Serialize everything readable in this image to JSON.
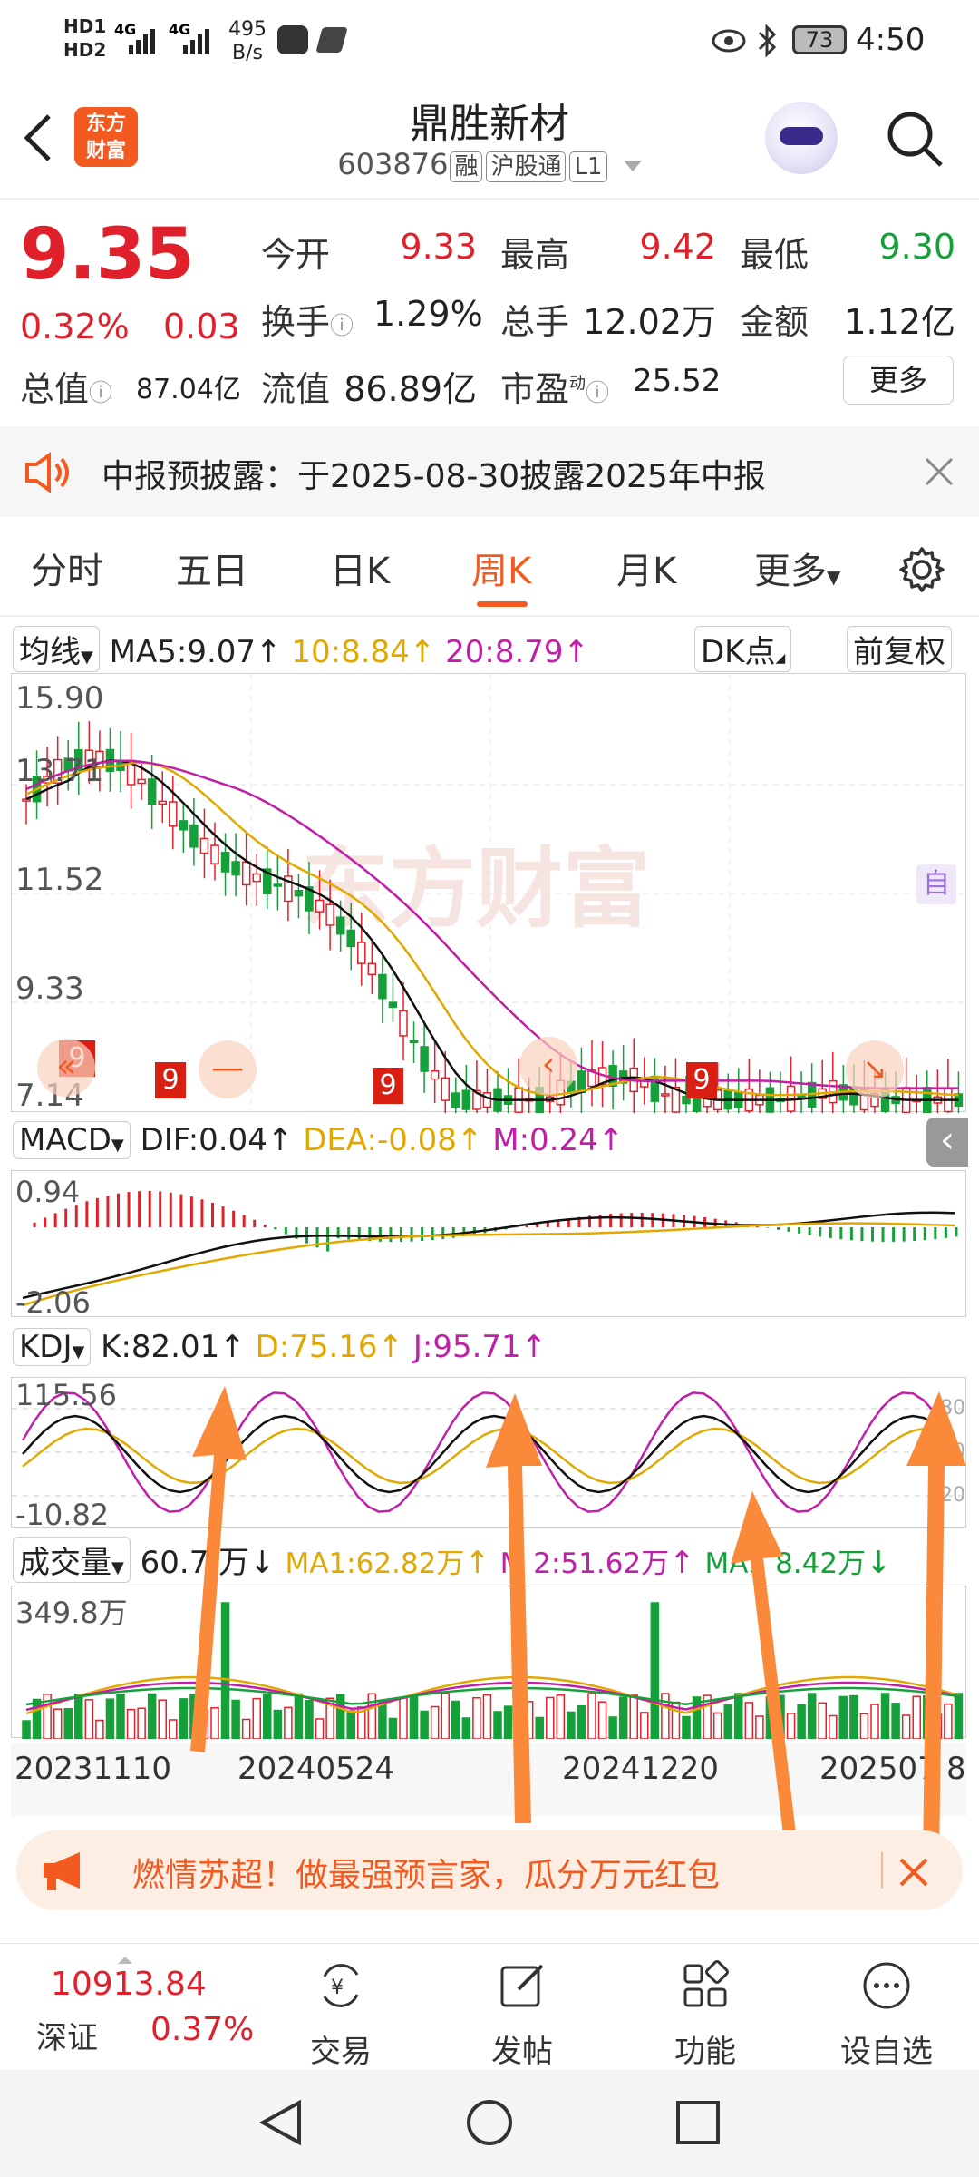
{
  "status_bar": {
    "left_icons": [
      "HD1",
      "HD2",
      "4G",
      "4G"
    ],
    "net_speed": "495",
    "net_unit": "B/s",
    "battery": "73",
    "time": "4:50"
  },
  "header": {
    "logo_text": "东方财富",
    "name": "鼎胜新材",
    "code": "603876",
    "tags": [
      "融",
      "沪股通",
      "L1"
    ]
  },
  "quote": {
    "price": "9.35",
    "change_pct": "0.32%",
    "change": "0.03",
    "open_label": "今开",
    "open": "9.33",
    "high_label": "最高",
    "high": "9.42",
    "low_label": "最低",
    "low": "9.30",
    "turnover_label": "换手",
    "turnover": "1.29%",
    "volume_label": "总手",
    "volume": "12.02万",
    "amount_label": "金额",
    "amount": "1.12亿",
    "mktcap_label": "总值",
    "mktcap": "87.04亿",
    "float_label": "流值",
    "float": "86.89亿",
    "pe_label": "市盈",
    "pe_sup": "动",
    "pe": "25.52",
    "more": "更多"
  },
  "notice": {
    "text": "中报预披露：于2025-08-30披露2025年中报"
  },
  "tabs": [
    {
      "label": "分时"
    },
    {
      "label": "五日"
    },
    {
      "label": "日K"
    },
    {
      "label": "周K"
    },
    {
      "label": "月K"
    },
    {
      "label": "更多"
    }
  ],
  "ma_bar": {
    "selector": "均线",
    "ma5": "MA5:9.07",
    "ma10": "10:8.84",
    "ma20": "20:8.79",
    "dk": "DK点",
    "adjust": "前复权"
  },
  "kline": {
    "y_labels": [
      "15.90",
      "13.71",
      "11.52",
      "9.33",
      "7.14"
    ],
    "watermark": "东方财富",
    "side_tag": "自",
    "nine_marks": [
      "9",
      "9",
      "9",
      "9"
    ]
  },
  "macd": {
    "selector": "MACD",
    "dif": "DIF:0.04",
    "dea": "DEA:-0.08",
    "m": "M:0.24",
    "y_top": "0.94",
    "y_bottom": "-2.06"
  },
  "kdj": {
    "selector": "KDJ",
    "k": "K:82.01",
    "d": "D:75.16",
    "j": "J:95.71",
    "y_top": "115.56",
    "y_bottom": "-10.82",
    "right_labels": [
      "80",
      "50",
      "20"
    ]
  },
  "volume": {
    "selector": "成交量",
    "value": "60.7",
    "value_tail": "万",
    "ma1": "MA1:62.82万",
    "ma2": "M",
    "ma2_tail": "2:51.62万",
    "ma3": "MA3",
    "ma3_tail": "8.42万",
    "y_top": "349.8万"
  },
  "x_dates": [
    "20231110",
    "20240524",
    "20241220",
    "202507",
    "8"
  ],
  "promo": {
    "text": "燃情苏超！做最强预言家，瓜分万元红包"
  },
  "bottom_bar": {
    "index_value": "10913.84",
    "index_name": "深证",
    "index_change": "0.37%",
    "items": [
      {
        "label": "交易",
        "icon": "trade-icon"
      },
      {
        "label": "发帖",
        "icon": "post-icon"
      },
      {
        "label": "功能",
        "icon": "apps-icon"
      },
      {
        "label": "设自选",
        "icon": "more-dots-icon"
      }
    ]
  },
  "colors": {
    "accent": "#f25a1f",
    "up": "#e0202a",
    "down": "#16a03a",
    "ma10": "#e2a800",
    "ma20": "#c21fa8"
  }
}
